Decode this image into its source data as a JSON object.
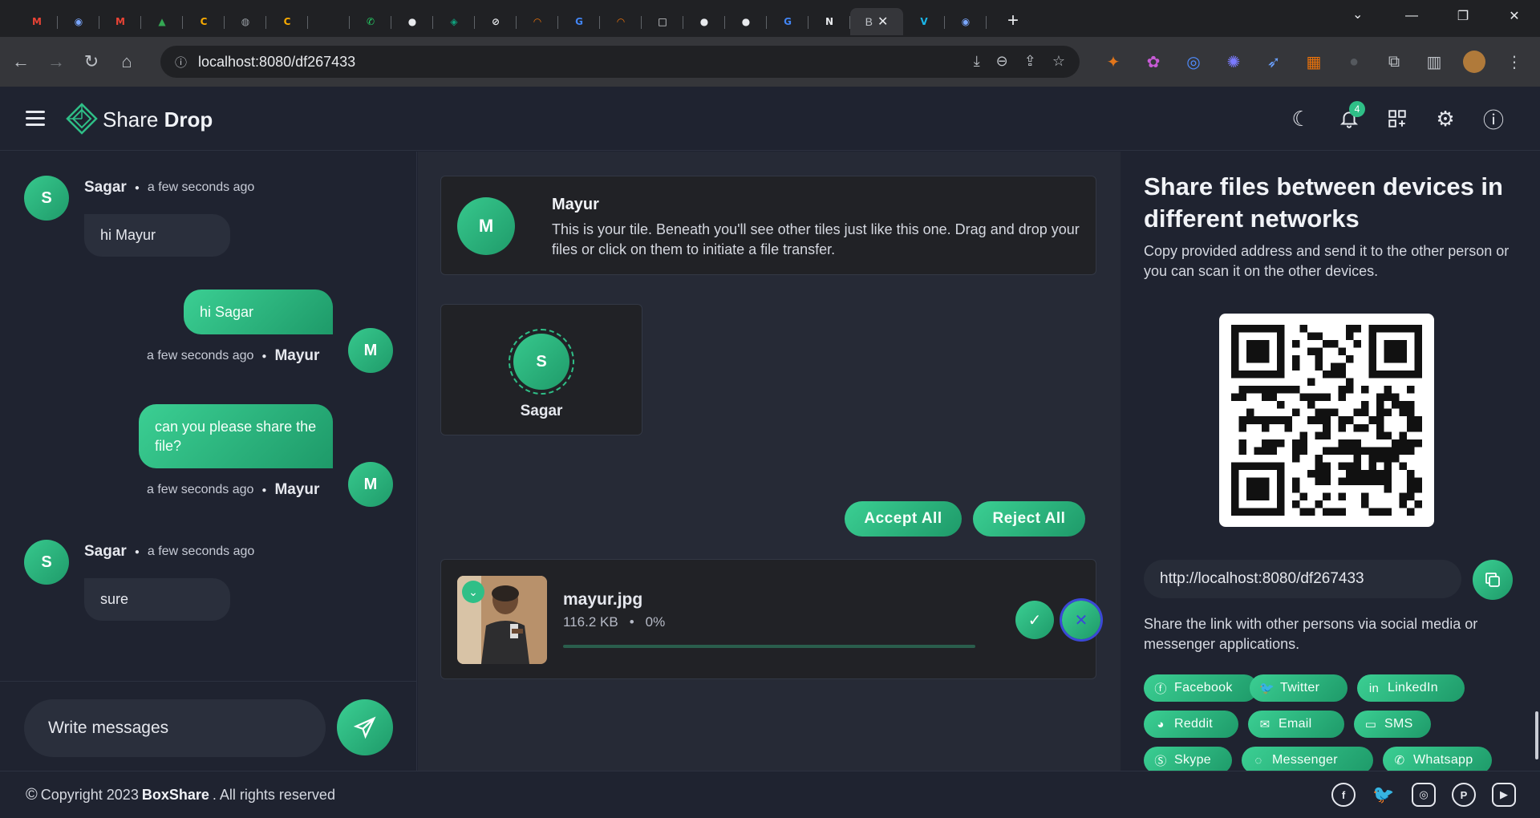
{
  "browser": {
    "tabs": [
      {
        "icon": "gmail-icon",
        "glyph": "M",
        "color": "#ea4335"
      },
      {
        "icon": "chrome-ext-icon",
        "glyph": "◉",
        "color": "#7aa7ff"
      },
      {
        "icon": "gmail-icon",
        "glyph": "M",
        "color": "#ea4335"
      },
      {
        "icon": "drive-icon",
        "glyph": "▲",
        "color": "#34a853"
      },
      {
        "icon": "c-icon",
        "glyph": "C",
        "color": "#f9ab00"
      },
      {
        "icon": "globe-icon",
        "glyph": "◍",
        "color": "#9aa0a6"
      },
      {
        "icon": "c-icon",
        "glyph": "C",
        "color": "#f9ab00"
      },
      {
        "icon": "blank-icon",
        "glyph": "",
        "color": "#202124"
      },
      {
        "icon": "whatsapp-icon",
        "glyph": "✆",
        "color": "#25d366"
      },
      {
        "icon": "github-icon",
        "glyph": "●",
        "color": "#e8eaed"
      },
      {
        "icon": "chatgpt-icon",
        "glyph": "◈",
        "color": "#10a37f"
      },
      {
        "icon": "slash-icon",
        "glyph": "⊘",
        "color": "#e8eaed"
      },
      {
        "icon": "rainbow-icon",
        "glyph": "◠",
        "color": "#e8710a"
      },
      {
        "icon": "google-icon",
        "glyph": "G",
        "color": "#4285f4"
      },
      {
        "icon": "rainbow-icon",
        "glyph": "◠",
        "color": "#e8710a"
      },
      {
        "icon": "square-icon",
        "glyph": "□",
        "color": "#e8eaed"
      },
      {
        "icon": "github-icon",
        "glyph": "●",
        "color": "#e8eaed"
      },
      {
        "icon": "github-icon",
        "glyph": "●",
        "color": "#e8eaed"
      },
      {
        "icon": "google-icon",
        "glyph": "G",
        "color": "#4285f4"
      },
      {
        "icon": "notion-icon",
        "glyph": "N",
        "color": "#e8eaed"
      }
    ],
    "active_tab_label": "B",
    "tabs_after": [
      {
        "icon": "vimeo-icon",
        "glyph": "V",
        "color": "#1ab7ea"
      },
      {
        "icon": "chrome-ext-icon",
        "glyph": "◉",
        "color": "#7aa7ff"
      }
    ],
    "url": "localhost:8080/df267433"
  },
  "header": {
    "brand_light": "Share ",
    "brand_bold": "Drop",
    "notification_count": "4"
  },
  "chat": {
    "messages": [
      {
        "side": "in",
        "author": "Sagar",
        "initial": "S",
        "time": "a few seconds ago",
        "text": "hi Mayur"
      },
      {
        "side": "out",
        "author": "Mayur",
        "initial": "M",
        "time": "a few seconds ago",
        "text": "hi Sagar"
      },
      {
        "side": "out",
        "author": "Mayur",
        "initial": "M",
        "time": "a few seconds ago",
        "text": "can you please share the file?"
      },
      {
        "side": "in",
        "author": "Sagar",
        "initial": "S",
        "time": "a few seconds ago",
        "text": "sure"
      }
    ],
    "composer_placeholder": "Write messages"
  },
  "main": {
    "my_tile": {
      "initial": "M",
      "name": "Mayur",
      "description": "This is your tile. Beneath you'll see other tiles just like this one. Drag and drop your files or click on them to initiate a file transfer."
    },
    "peer": {
      "initial": "S",
      "name": "Sagar"
    },
    "accept_all": "Accept All",
    "reject_all": "Reject All",
    "file": {
      "name": "mayur.jpg",
      "size": "116.2 KB",
      "progress_label": "0%",
      "progress": 0
    }
  },
  "share": {
    "title": "Share files between devices in different networks",
    "subtitle": "Copy provided address and send it to the other person or you can scan it on the other devices.",
    "link": "http://localhost:8080/df267433",
    "social_text": "Share the link with other persons via social media or messenger applications.",
    "buttons": [
      {
        "label": "Facebook",
        "icon": "facebook-icon",
        "glyph": "ⓕ"
      },
      {
        "label": "Twitter",
        "icon": "twitter-icon",
        "glyph": "🐦"
      },
      {
        "label": "LinkedIn",
        "icon": "linkedin-icon",
        "glyph": "in"
      },
      {
        "label": "Reddit",
        "icon": "reddit-icon",
        "glyph": "◕"
      },
      {
        "label": "Email",
        "icon": "email-icon",
        "glyph": "✉"
      },
      {
        "label": "SMS",
        "icon": "sms-icon",
        "glyph": "▭"
      },
      {
        "label": "Skype",
        "icon": "skype-icon",
        "glyph": "Ⓢ"
      },
      {
        "label": "Messenger",
        "icon": "messenger-icon",
        "glyph": "◌"
      },
      {
        "label": "Whatsapp",
        "icon": "whatsapp-icon",
        "glyph": "✆"
      }
    ]
  },
  "footer": {
    "copyright_prefix": "Copyright 2023 ",
    "company": "BoxShare",
    "copyright_suffix": ". All rights reserved",
    "social": [
      "facebook-icon",
      "twitter-icon",
      "instagram-icon",
      "pinterest-icon",
      "youtube-icon"
    ]
  },
  "colors": {
    "accent": "#2fbf87",
    "background": "#1f2330",
    "panel": "#262a36",
    "tile": "#212226"
  }
}
